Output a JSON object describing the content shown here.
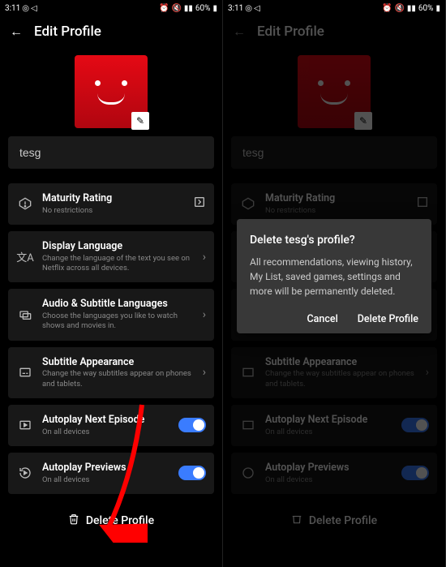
{
  "status": {
    "time": "3:11",
    "battery": "60%"
  },
  "header": {
    "title": "Edit Profile"
  },
  "profile": {
    "name": "tesg"
  },
  "rows": {
    "maturity": {
      "title": "Maturity Rating",
      "sub": "No restrictions"
    },
    "display": {
      "title": "Display Language",
      "sub": "Change the language of the text you see on Netflix across all devices."
    },
    "audio": {
      "title": "Audio & Subtitle Languages",
      "sub": "Choose the languages you like to watch shows and movies in."
    },
    "subtitle": {
      "title": "Subtitle Appearance",
      "sub": "Change the way subtitles appear on phones and tablets."
    },
    "autonext": {
      "title": "Autoplay Next Episode",
      "sub": "On all devices"
    },
    "autoprev": {
      "title": "Autoplay Previews",
      "sub": "On all devices"
    }
  },
  "delete_label": "Delete Profile",
  "dialog": {
    "title": "Delete tesg's profile?",
    "body": "All recommendations, viewing history, My List, saved games, settings and more will be permanently deleted.",
    "cancel": "Cancel",
    "confirm": "Delete Profile"
  }
}
